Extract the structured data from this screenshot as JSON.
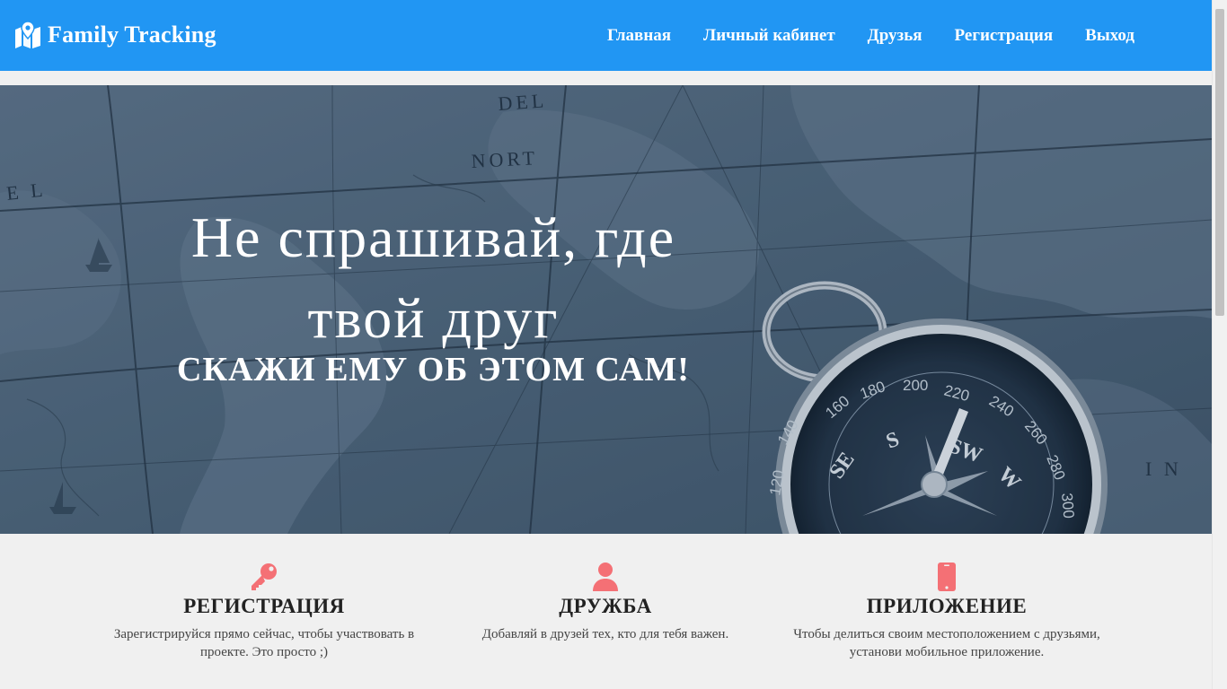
{
  "nav": {
    "brand": "Family Tracking",
    "brand_icon": "map-marker-icon",
    "links": [
      "Главная",
      "Личный кабинет",
      "Друзья",
      "Регистрация",
      "Выход"
    ]
  },
  "hero": {
    "title": "Не спрашивай, где твой друг",
    "subtitle": "СКАЖИ ЕМУ ОБ ЭТОМ САМ!",
    "map_labels": [
      "DEL",
      "NORT",
      "E L",
      "I N"
    ],
    "compass_labels": [
      "140",
      "160",
      "180",
      "200",
      "220",
      "240",
      "260",
      "280",
      "300",
      "120",
      "SE",
      "S",
      "SW",
      "W"
    ]
  },
  "features": [
    {
      "icon": "key-icon",
      "title": "РЕГИСТРАЦИЯ",
      "text": "Зарегистрируйся прямо сейчас, чтобы участвовать в проекте. Это просто ;)"
    },
    {
      "icon": "user-icon",
      "title": "ДРУЖБА",
      "text": "Добавляй в друзей тех, кто для тебя важен."
    },
    {
      "icon": "mobile-phone-icon",
      "title": "ПРИЛОЖЕНИЕ",
      "text": "Чтобы делиться своим местоположением с друзьями, установи мобильное приложение."
    }
  ],
  "colors": {
    "navbar": "#2196f3",
    "accent_icon": "#f47075",
    "hero_tint": "#4e6478"
  }
}
